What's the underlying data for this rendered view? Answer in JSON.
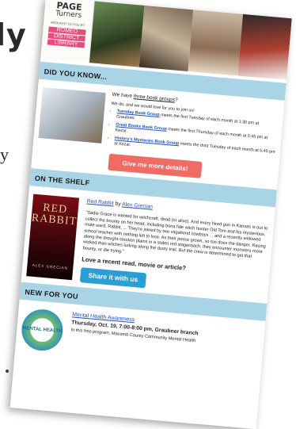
{
  "backdrop": {
    "word": "ly",
    "mark": "y"
  },
  "banner": {
    "logo_title_1": "PAGE",
    "logo_title_2": "Turners",
    "logo_sub": "BROUGHT TO YOU BY",
    "brand_lines": [
      "ROMEO",
      "DISTRICT",
      "LIBRARY"
    ]
  },
  "dyk": {
    "heading": "DID YOU KNOW...",
    "intro_pre": "We have ",
    "intro_link": "three book groups",
    "intro_post": "?",
    "lead": "We do, and we would love for you to join us!",
    "groups": [
      {
        "name": "Tuesday Book Group",
        "text": " meets the first Tuesday of each month at 1:30 pm at Graubner."
      },
      {
        "name": "Great Books Book Group",
        "text": " meets the first Thursday of each month at 5:45 pm at Kezar."
      },
      {
        "name": "History's Mysteries Book Group",
        "text": " meets the third Tuesday of each month at 5:45 pm at Kezar."
      }
    ],
    "button": "Give me more details!"
  },
  "shelf": {
    "heading": "ON THE SHELF",
    "cover_title_1": "RED",
    "cover_title_2": "RABBIT",
    "cover_author": "ALEX GRECIAN",
    "book_title": "Red Rabbit",
    "by": " by ",
    "author": "Alex Grecian",
    "blurb": "\"Sadie Grace is wanted for witchcraft, dead (or alive). And every hired gun in Kansas is out to collect the bounty on her head, including bona fide witch hunter Old Tom and his mysterious, mute ward, Rabbit. ... They're joined by two vagabond cowboys ... and a recently widowed school teacher with nothing left to lose. As their posse grows, so too does the danger. Racing along the drought-stricken plains in a stolen red stagecoach, they encounter monsters more wicked than witches lurking along the dusty trail. But the crew is determined to get that bounty, or die trying.\"",
    "prompt": "Love a recent read, movie or article?",
    "button": "Share it with us"
  },
  "new": {
    "heading": "NEW FOR YOU",
    "logo_text": "MENTAL HEALTH",
    "title": "Mental Health Awareness",
    "when": "Thursday, Oct. 19, 7:00-8:00 pm, Graubner branch",
    "desc": "In this free program, Macomb County Community Mental Health"
  }
}
